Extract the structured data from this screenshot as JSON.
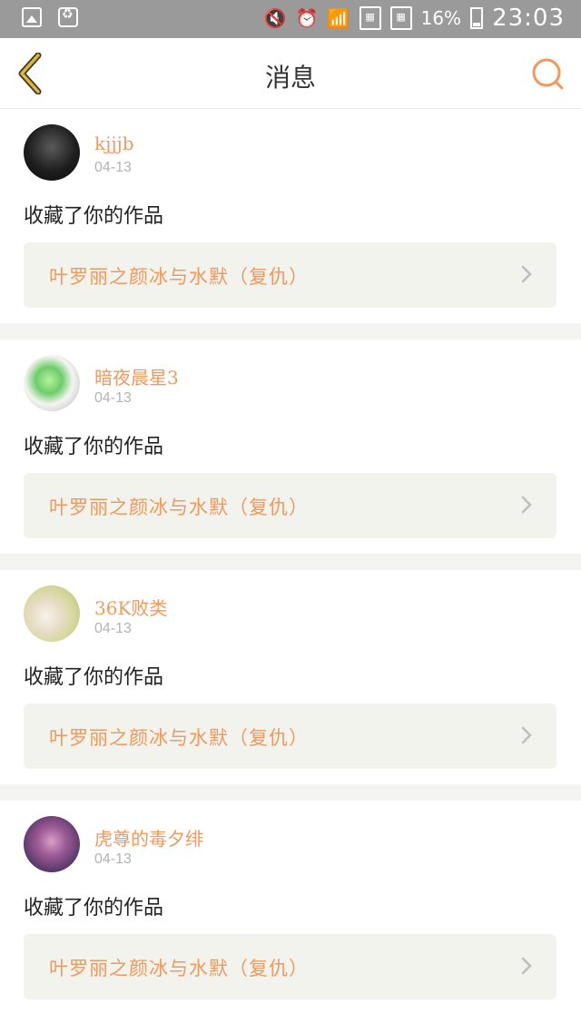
{
  "status_bar": {
    "battery": "16%",
    "time": "23:03",
    "icons": [
      "photo-icon",
      "recycle-icon",
      "mute-icon",
      "alarm-icon",
      "wifi-icon",
      "sim-icon",
      "sim-icon",
      "battery-icon"
    ]
  },
  "header": {
    "title": "消息",
    "back_icon": "chevron-left-icon",
    "search_icon": "search-icon"
  },
  "colors": {
    "accent": "#f0995d",
    "back_arrow": "#e3b33a",
    "card_bg": "#f3f3ee",
    "divider": "#f4f4f2"
  },
  "messages": [
    {
      "user": "kjjjb",
      "date": "04-13",
      "action": "收藏了你的作品",
      "work": "叶罗丽之颜冰与水默（复仇）"
    },
    {
      "user": "暗夜晨星3",
      "date": "04-13",
      "action": "收藏了你的作品",
      "work": "叶罗丽之颜冰与水默（复仇）"
    },
    {
      "user": "36K败类",
      "date": "04-13",
      "action": "收藏了你的作品",
      "work": "叶罗丽之颜冰与水默（复仇）"
    },
    {
      "user": "虎尊的毒夕绯",
      "date": "04-13",
      "action": "收藏了你的作品",
      "work": "叶罗丽之颜冰与水默（复仇）"
    }
  ]
}
